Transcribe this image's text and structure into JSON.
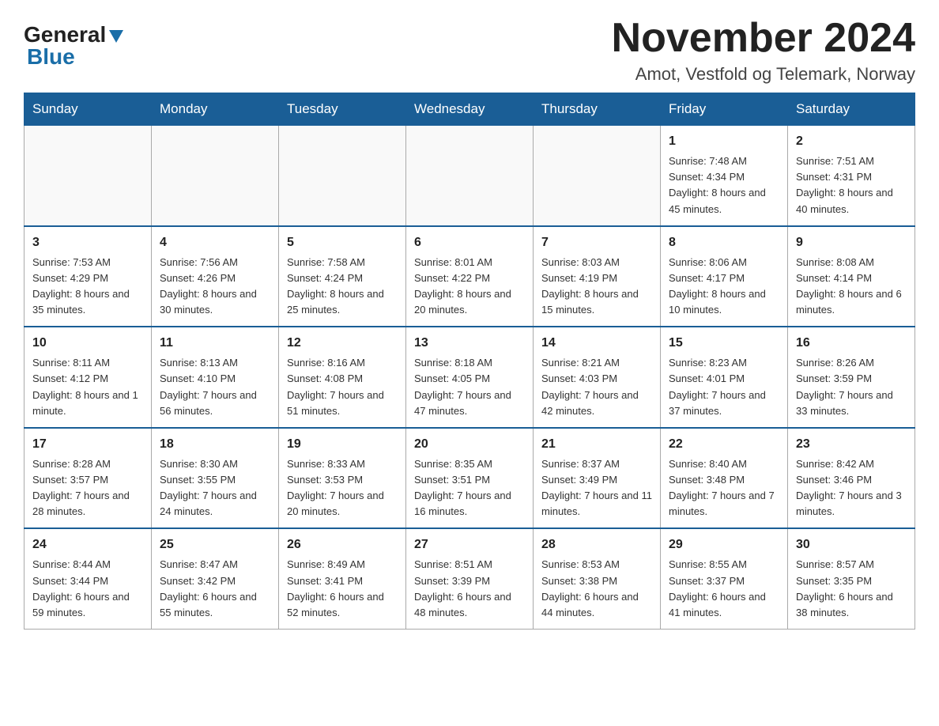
{
  "logo": {
    "general": "General",
    "blue": "Blue"
  },
  "header": {
    "month_year": "November 2024",
    "subtitle": "Amot, Vestfold og Telemark, Norway"
  },
  "weekdays": [
    "Sunday",
    "Monday",
    "Tuesday",
    "Wednesday",
    "Thursday",
    "Friday",
    "Saturday"
  ],
  "weeks": [
    [
      {
        "day": "",
        "info": ""
      },
      {
        "day": "",
        "info": ""
      },
      {
        "day": "",
        "info": ""
      },
      {
        "day": "",
        "info": ""
      },
      {
        "day": "",
        "info": ""
      },
      {
        "day": "1",
        "info": "Sunrise: 7:48 AM\nSunset: 4:34 PM\nDaylight: 8 hours and 45 minutes."
      },
      {
        "day": "2",
        "info": "Sunrise: 7:51 AM\nSunset: 4:31 PM\nDaylight: 8 hours and 40 minutes."
      }
    ],
    [
      {
        "day": "3",
        "info": "Sunrise: 7:53 AM\nSunset: 4:29 PM\nDaylight: 8 hours and 35 minutes."
      },
      {
        "day": "4",
        "info": "Sunrise: 7:56 AM\nSunset: 4:26 PM\nDaylight: 8 hours and 30 minutes."
      },
      {
        "day": "5",
        "info": "Sunrise: 7:58 AM\nSunset: 4:24 PM\nDaylight: 8 hours and 25 minutes."
      },
      {
        "day": "6",
        "info": "Sunrise: 8:01 AM\nSunset: 4:22 PM\nDaylight: 8 hours and 20 minutes."
      },
      {
        "day": "7",
        "info": "Sunrise: 8:03 AM\nSunset: 4:19 PM\nDaylight: 8 hours and 15 minutes."
      },
      {
        "day": "8",
        "info": "Sunrise: 8:06 AM\nSunset: 4:17 PM\nDaylight: 8 hours and 10 minutes."
      },
      {
        "day": "9",
        "info": "Sunrise: 8:08 AM\nSunset: 4:14 PM\nDaylight: 8 hours and 6 minutes."
      }
    ],
    [
      {
        "day": "10",
        "info": "Sunrise: 8:11 AM\nSunset: 4:12 PM\nDaylight: 8 hours and 1 minute."
      },
      {
        "day": "11",
        "info": "Sunrise: 8:13 AM\nSunset: 4:10 PM\nDaylight: 7 hours and 56 minutes."
      },
      {
        "day": "12",
        "info": "Sunrise: 8:16 AM\nSunset: 4:08 PM\nDaylight: 7 hours and 51 minutes."
      },
      {
        "day": "13",
        "info": "Sunrise: 8:18 AM\nSunset: 4:05 PM\nDaylight: 7 hours and 47 minutes."
      },
      {
        "day": "14",
        "info": "Sunrise: 8:21 AM\nSunset: 4:03 PM\nDaylight: 7 hours and 42 minutes."
      },
      {
        "day": "15",
        "info": "Sunrise: 8:23 AM\nSunset: 4:01 PM\nDaylight: 7 hours and 37 minutes."
      },
      {
        "day": "16",
        "info": "Sunrise: 8:26 AM\nSunset: 3:59 PM\nDaylight: 7 hours and 33 minutes."
      }
    ],
    [
      {
        "day": "17",
        "info": "Sunrise: 8:28 AM\nSunset: 3:57 PM\nDaylight: 7 hours and 28 minutes."
      },
      {
        "day": "18",
        "info": "Sunrise: 8:30 AM\nSunset: 3:55 PM\nDaylight: 7 hours and 24 minutes."
      },
      {
        "day": "19",
        "info": "Sunrise: 8:33 AM\nSunset: 3:53 PM\nDaylight: 7 hours and 20 minutes."
      },
      {
        "day": "20",
        "info": "Sunrise: 8:35 AM\nSunset: 3:51 PM\nDaylight: 7 hours and 16 minutes."
      },
      {
        "day": "21",
        "info": "Sunrise: 8:37 AM\nSunset: 3:49 PM\nDaylight: 7 hours and 11 minutes."
      },
      {
        "day": "22",
        "info": "Sunrise: 8:40 AM\nSunset: 3:48 PM\nDaylight: 7 hours and 7 minutes."
      },
      {
        "day": "23",
        "info": "Sunrise: 8:42 AM\nSunset: 3:46 PM\nDaylight: 7 hours and 3 minutes."
      }
    ],
    [
      {
        "day": "24",
        "info": "Sunrise: 8:44 AM\nSunset: 3:44 PM\nDaylight: 6 hours and 59 minutes."
      },
      {
        "day": "25",
        "info": "Sunrise: 8:47 AM\nSunset: 3:42 PM\nDaylight: 6 hours and 55 minutes."
      },
      {
        "day": "26",
        "info": "Sunrise: 8:49 AM\nSunset: 3:41 PM\nDaylight: 6 hours and 52 minutes."
      },
      {
        "day": "27",
        "info": "Sunrise: 8:51 AM\nSunset: 3:39 PM\nDaylight: 6 hours and 48 minutes."
      },
      {
        "day": "28",
        "info": "Sunrise: 8:53 AM\nSunset: 3:38 PM\nDaylight: 6 hours and 44 minutes."
      },
      {
        "day": "29",
        "info": "Sunrise: 8:55 AM\nSunset: 3:37 PM\nDaylight: 6 hours and 41 minutes."
      },
      {
        "day": "30",
        "info": "Sunrise: 8:57 AM\nSunset: 3:35 PM\nDaylight: 6 hours and 38 minutes."
      }
    ]
  ]
}
